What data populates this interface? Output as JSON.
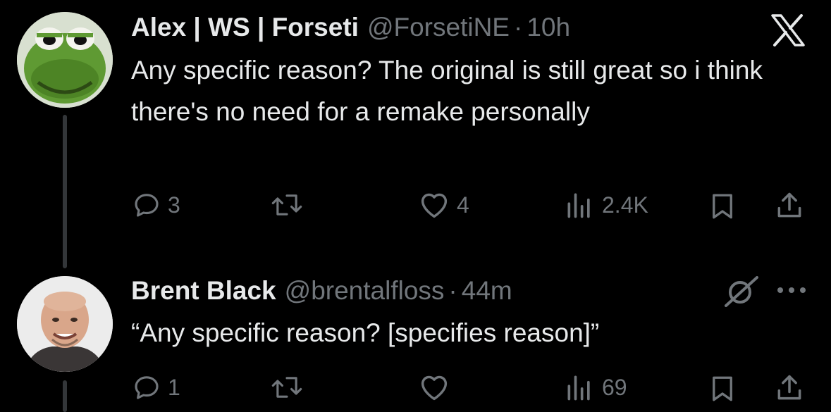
{
  "tweets": [
    {
      "author_name": "Alex | WS | Forseti",
      "handle": "@ForsetiNE",
      "separator": "·",
      "time": "10h",
      "corner_icon": "x-logo-icon",
      "text": "Any specific reason? The original is still great so i think there's no need for a remake personally",
      "avatar_icon": "kermit-avatar",
      "actions": {
        "replies": "3",
        "retweets": "",
        "likes": "4",
        "views": "2.4K"
      }
    },
    {
      "author_name": "Brent Black",
      "handle": "@brentalfloss",
      "separator": "·",
      "time": "44m",
      "corner_icon": "grok-icon",
      "more_icon": "more-dots-icon",
      "text": "“Any specific reason? [specifies reason]”",
      "avatar_icon": "person-avatar",
      "actions": {
        "replies": "1",
        "retweets": "",
        "likes": "",
        "views": "69"
      }
    }
  ],
  "colors": {
    "background": "#000000",
    "text": "#e7e9ea",
    "muted": "#71767b",
    "thread_line": "#333639"
  }
}
